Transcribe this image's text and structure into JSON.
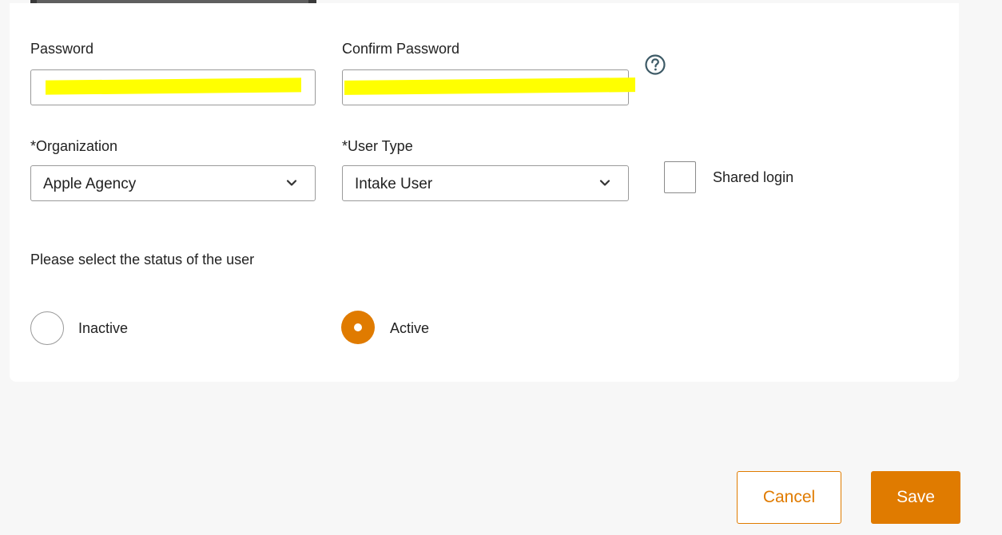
{
  "form": {
    "password_label": "Password",
    "confirm_password_label": "Confirm Password",
    "organization_label": "*Organization",
    "organization_value": "Apple Agency",
    "user_type_label": "*User Type",
    "user_type_value": "Intake User",
    "shared_login_label": "Shared login",
    "status_prompt": "Please select the status of the user",
    "status_options": [
      {
        "label": "Inactive",
        "selected": false
      },
      {
        "label": "Active",
        "selected": true
      }
    ]
  },
  "actions": {
    "cancel_label": "Cancel",
    "save_label": "Save"
  },
  "icons": {
    "help": "help-circle-icon",
    "dropdown": "chevron-down-icon"
  },
  "colors": {
    "accent": "#e07b00",
    "highlight": "#ffff00",
    "help_icon": "#3d5a66"
  }
}
